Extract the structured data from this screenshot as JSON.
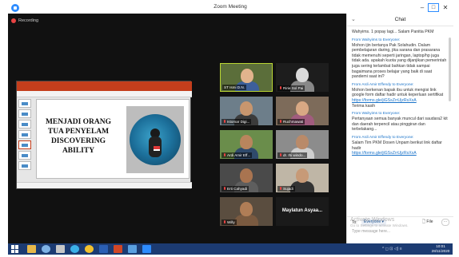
{
  "window": {
    "title": "Zoom Meeting",
    "minimize": "–",
    "maximize": "□",
    "close": "✕"
  },
  "meeting": {
    "recording_label": "Recording"
  },
  "slide": {
    "title": "MENJADI ORANG TUA PENYELAM DISCOVERING ABILITY"
  },
  "tiles": [
    {
      "name": "ST Ismi D.N.",
      "muted": false
    },
    {
      "name": "Ririe Sol Pai",
      "muted": true
    },
    {
      "name": "Istomar Digi...",
      "muted": true
    },
    {
      "name": "Ruchmawati",
      "muted": true
    },
    {
      "name": "Ardi Amir Eff...",
      "muted": true
    },
    {
      "name": "dr. Ihi windo...",
      "muted": true
    },
    {
      "name": "Erti Cahyadi",
      "muted": true
    },
    {
      "name": "Sujadi",
      "muted": true
    },
    {
      "name": "Willy",
      "muted": true
    },
    {
      "name": "Maylatun  Asyaa...",
      "muted": false,
      "text_only": true
    }
  ],
  "chat": {
    "title": "Chat",
    "messages": [
      {
        "sender": "",
        "text": "Wahyims. 1 popay lagi... Salam Panitia PKM"
      },
      {
        "sender": "From Wahyims to Everyone:",
        "text": "Mohon ijin bertanya Pak Solahudin. Dalam pembelajaran daring, jika sarana dan prasarana tidak memenuhi seperti jaringan, laptop/hp juga tidak ada. apakah kuota yang dijanjikan pemerintah juga sering terlambat bahkan tidak sampai bagaimana proses belajar yang baik di saat pandemi saat ini?"
      },
      {
        "sender": "From Ardi Amir Effendy to Everyone:",
        "text": "Mohon berkenan bapak ibu untuk mengisi link google form daftar hadir untuk keperluan sertifikat",
        "link": "https://forms.gle/jiGSsZrrUjzRsXxA",
        "after": "Terima kasih"
      },
      {
        "sender": "From Wahyims to Everyone:",
        "text": "Pertanyaan semua banyak muncul dari saudara2 kit dan daerah terpencil atau pinggiran dan terbelakang..."
      },
      {
        "sender": "From Ardi Amir Effendy to Everyone:",
        "text": "Salam Tim PKM Dosen Unpam berikut link daftar hadir",
        "link": "https://forms.gle/jiGSsZrrUjzRsXxA"
      }
    ],
    "to_label": "To:",
    "to_value": "Everyone ▾",
    "file_label": "File",
    "more_label": "···",
    "input_placeholder": "Type message here...",
    "watermark_line1": "Activate Windows",
    "watermark_line2": "Go to Settings to activate Windows."
  },
  "taskbar": {
    "clock_time": "10:01",
    "clock_date": "28/11/2020",
    "tray_text": "^ ◻ ⊡ ◁) ≡"
  },
  "colors": {
    "zoom_blue": "#2d8cff",
    "speaking_border": "#b9d533",
    "taskbar": "#1c3b72",
    "ppt_red": "#c43e1c"
  }
}
